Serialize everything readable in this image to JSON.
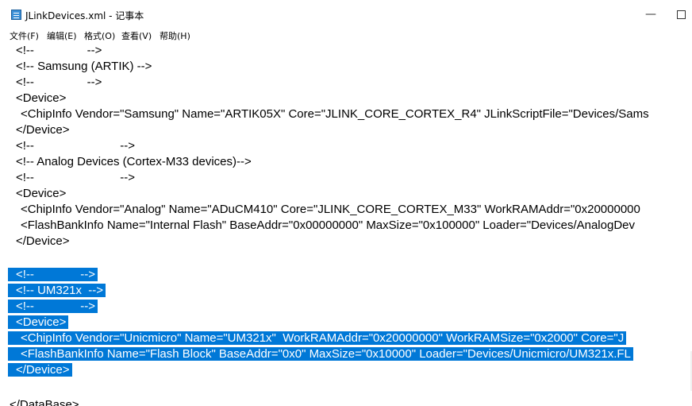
{
  "window": {
    "title": "JLinkDevices.xml - 记事本",
    "minimize_label": "—",
    "maximize_label": ""
  },
  "menu": {
    "items": [
      "文件(F)",
      "编辑(E)",
      "格式(O)",
      "查看(V)",
      "帮助(H)"
    ]
  },
  "editor": {
    "lines": [
      {
        "text": "<!--                -->",
        "selected": false,
        "indent": 1
      },
      {
        "text": "<!-- Samsung (ARTIK) -->",
        "selected": false,
        "indent": 1
      },
      {
        "text": "<!--                -->",
        "selected": false,
        "indent": 1
      },
      {
        "text": "<Device>",
        "selected": false,
        "indent": 1
      },
      {
        "text": "<ChipInfo Vendor=\"Samsung\" Name=\"ARTIK05X\" Core=\"JLINK_CORE_CORTEX_R4\" JLinkScriptFile=\"Devices/Sams",
        "selected": false,
        "indent": 2
      },
      {
        "text": "</Device>",
        "selected": false,
        "indent": 1
      },
      {
        "text": "<!--                          -->",
        "selected": false,
        "indent": 1
      },
      {
        "text": "<!-- Analog Devices (Cortex-M33 devices)-->",
        "selected": false,
        "indent": 1
      },
      {
        "text": "<!--                          -->",
        "selected": false,
        "indent": 1
      },
      {
        "text": "<Device>",
        "selected": false,
        "indent": 1
      },
      {
        "text": "<ChipInfo Vendor=\"Analog\" Name=\"ADuCM410\" Core=\"JLINK_CORE_CORTEX_M33\" WorkRAMAddr=\"0x20000000",
        "selected": false,
        "indent": 2
      },
      {
        "text": "<FlashBankInfo Name=\"Internal Flash\" BaseAddr=\"0x00000000\" MaxSize=\"0x100000\" Loader=\"Devices/AnalogDev",
        "selected": false,
        "indent": 2
      },
      {
        "text": "</Device>",
        "selected": false,
        "indent": 1
      },
      {
        "text": "",
        "selected": false,
        "indent": 0
      },
      {
        "text": "<!--              -->",
        "selected": true,
        "indent": 1
      },
      {
        "text": "<!-- UM321x  -->",
        "selected": true,
        "indent": 1
      },
      {
        "text": "<!--              -->",
        "selected": true,
        "indent": 1
      },
      {
        "text": "<Device>",
        "selected": true,
        "indent": 1
      },
      {
        "text": "<ChipInfo Vendor=\"Unicmicro\" Name=\"UM321x\"  WorkRAMAddr=\"0x20000000\" WorkRAMSize=\"0x2000\" Core=\"J",
        "selected": true,
        "indent": 2
      },
      {
        "text": "<FlashBankInfo Name=\"Flash Block\" BaseAddr=\"0x0\" MaxSize=\"0x10000\" Loader=\"Devices/Unicmicro/UM321x.FL",
        "selected": true,
        "indent": 2
      },
      {
        "text": "</Device>",
        "selected": true,
        "indent": 1
      },
      {
        "text": "",
        "selected": false,
        "indent": 0
      },
      {
        "text": "</DataBase>",
        "selected": false,
        "indent": 0
      }
    ]
  },
  "colors": {
    "selection": "#0078d7",
    "selection_text": "#ffffff",
    "icon": "#3a8fd6"
  },
  "icons": {
    "app": "notepad-icon"
  }
}
